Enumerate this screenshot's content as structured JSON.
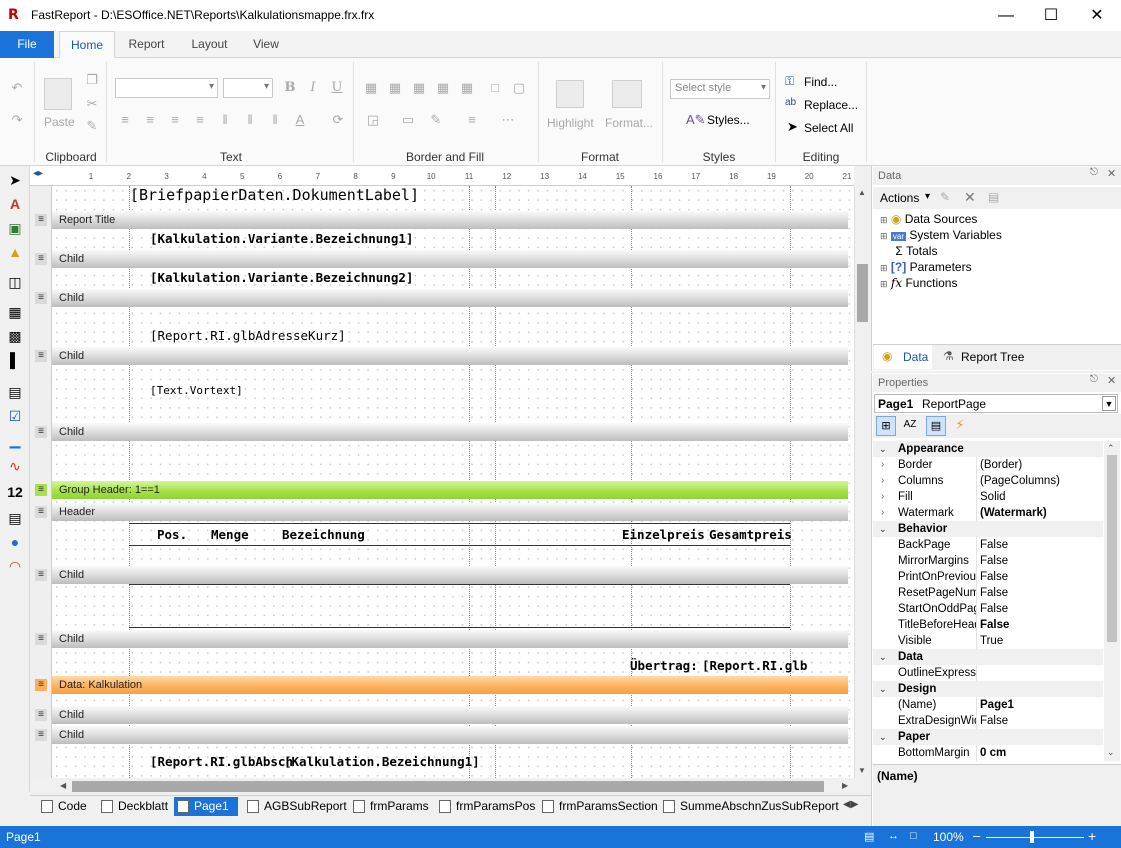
{
  "window": {
    "title": "FastReport - D:\\ESOffice.NET\\Reports\\Kalkulationsmappe.frx.frx",
    "logo": "R"
  },
  "tabs": [
    "File",
    "Home",
    "Report",
    "Layout",
    "View"
  ],
  "ribbon": {
    "clipboard": {
      "label": "Clipboard",
      "paste": "Paste"
    },
    "text": {
      "label": "Text"
    },
    "border_fill": {
      "label": "Border and Fill"
    },
    "format": {
      "label": "Format",
      "highlight": "Highlight",
      "format_btn": "Format..."
    },
    "styles": {
      "label": "Styles",
      "select_style_placeholder": "Select style",
      "styles_btn": "Styles..."
    },
    "editing": {
      "label": "Editing",
      "find": "Find...",
      "replace": "Replace...",
      "select_all": "Select All"
    }
  },
  "ruler": [
    "1",
    "2",
    "3",
    "4",
    "5",
    "6",
    "7",
    "8",
    "9",
    "10",
    "11",
    "12",
    "13",
    "14",
    "15",
    "16",
    "17",
    "18",
    "19",
    "20",
    "21"
  ],
  "bands": {
    "report_title": "Report Title",
    "child": "Child",
    "group_header": "Group Header: 1==1",
    "header": "Header",
    "data": "Data: Kalkulation"
  },
  "fields": {
    "dokumentlabel": "[BriefpapierDaten.DokumentLabel]",
    "variante1": "[Kalkulation.Variante.Bezeichnung1]",
    "variante2": "[Kalkulation.Variante.Bezeichnung2]",
    "adresse": "[Report.RI.glbAdresseKurz]",
    "vortext": "[Text.Vortext]",
    "col_pos": "Pos.",
    "col_menge": "Menge",
    "col_bezeichnung": "Bezeichnung",
    "col_einzelpreis": "Einzelpreis",
    "col_gesamtpreis": "Gesamtpreis",
    "uebertrag": "Übertrag:",
    "uebertrag_val": "[Report.RI.glb",
    "glbabsch": "[Report.RI.glbAbsch",
    "kalk_bez1": "[Kalkulation.Bezeichnung1]"
  },
  "page_tabs": [
    "Code",
    "Deckblatt",
    "Page1",
    "AGBSubReport",
    "frmParams",
    "frmParamsPos",
    "frmParamsSection",
    "SummeAbschnZusSubReport"
  ],
  "status": {
    "page": "Page1",
    "zoom": "100%"
  },
  "data_panel": {
    "title": "Data",
    "actions": "Actions",
    "tree": [
      "Data Sources",
      "System Variables",
      "Totals",
      "Parameters",
      "Functions"
    ],
    "tab_data": "Data",
    "tab_report_tree": "Report Tree"
  },
  "properties": {
    "title": "Properties",
    "selected_object": "Page1",
    "selected_type": "ReportPage",
    "rows": [
      {
        "cat": true,
        "name": "Appearance"
      },
      {
        "name": "Border",
        "value": "(Border)"
      },
      {
        "name": "Columns",
        "value": "(PageColumns)"
      },
      {
        "name": "Fill",
        "value": "Solid"
      },
      {
        "name": "Watermark",
        "value": "(Watermark)",
        "bold": true
      },
      {
        "cat": true,
        "name": "Behavior"
      },
      {
        "name": "BackPage",
        "value": "False"
      },
      {
        "name": "MirrorMargins",
        "value": "False"
      },
      {
        "name": "PrintOnPreviousPage",
        "value": "False"
      },
      {
        "name": "ResetPageNumber",
        "value": "False"
      },
      {
        "name": "StartOnOddPage",
        "value": "False"
      },
      {
        "name": "TitleBeforeHeader",
        "value": "False",
        "bold": true
      },
      {
        "name": "Visible",
        "value": "True"
      },
      {
        "cat": true,
        "name": "Data"
      },
      {
        "name": "OutlineExpression",
        "value": ""
      },
      {
        "cat": true,
        "name": "Design"
      },
      {
        "name": "(Name)",
        "value": "Page1",
        "bold": true
      },
      {
        "name": "ExtraDesignWidth",
        "value": "False"
      },
      {
        "cat": true,
        "name": "Paper"
      },
      {
        "name": "BottomMargin",
        "value": "0 cm",
        "bold": true
      }
    ],
    "description_title": "(Name)"
  }
}
